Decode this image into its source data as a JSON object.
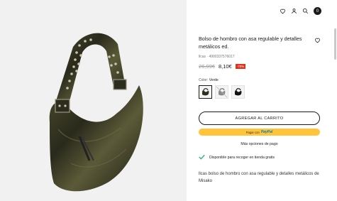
{
  "header": {
    "wishlist_icon": "heart-icon",
    "account_icon": "user-icon",
    "search_icon": "search-icon",
    "cart_count": "0"
  },
  "product": {
    "title": "Bolso de hombro con asa regulable y detalles metálicos ed.",
    "reference": "llcas · 4900337576017",
    "old_price": "26,99€",
    "new_price": "8,10€",
    "discount": "-70%",
    "color_label": "Color:",
    "color_value": "Verde",
    "swatches": [
      "Verde",
      "Gris",
      "Negro"
    ],
    "add_to_cart": "AGREGAR AL CARRITO",
    "paypal_prefix": "Pagar con",
    "paypal_brand_a": "Pay",
    "paypal_brand_b": "Pal",
    "more_payment": "Más opciones de pago",
    "pickup": "Disponible para recoger en tienda gratis",
    "description": "llcas bolso de hombro con asa regulable y detalles metálicos de Misako"
  },
  "colors": {
    "accent": "#1a1a1a",
    "paypal": "#ffc439",
    "discount": "#e0301e",
    "check": "#2bb673"
  }
}
